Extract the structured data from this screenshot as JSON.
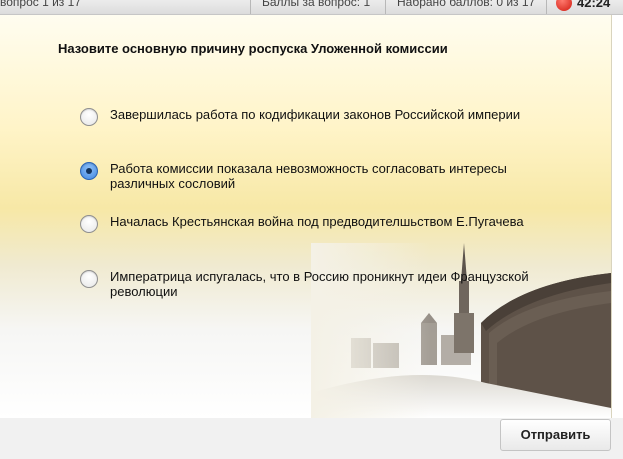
{
  "header": {
    "question_counter": "вопрос 1 из 17",
    "score_label": "Баллы за вопрос: 1",
    "total_score": "Набрано баллов: 0 из 17",
    "timer": "42:24"
  },
  "question": {
    "text": "Назовите основную причину роспуска Уложенной комиссии"
  },
  "options": [
    {
      "text": "Завершилась работа по кодификации законов Российской империи",
      "selected": false
    },
    {
      "text": "Работа комиссии показала невозможность согласовать интересы различных сословий",
      "selected": true
    },
    {
      "text": "Началась Крестьянская война под предводителшьством Е.Пугачева",
      "selected": false
    },
    {
      "text": "Императрица испугалась, что в Россию проникнут идеи Французской революции",
      "selected": false
    }
  ],
  "footer": {
    "submit_label": "Отправить"
  },
  "colors": {
    "accent": "#3f86e0",
    "timer": "#d01a10"
  }
}
